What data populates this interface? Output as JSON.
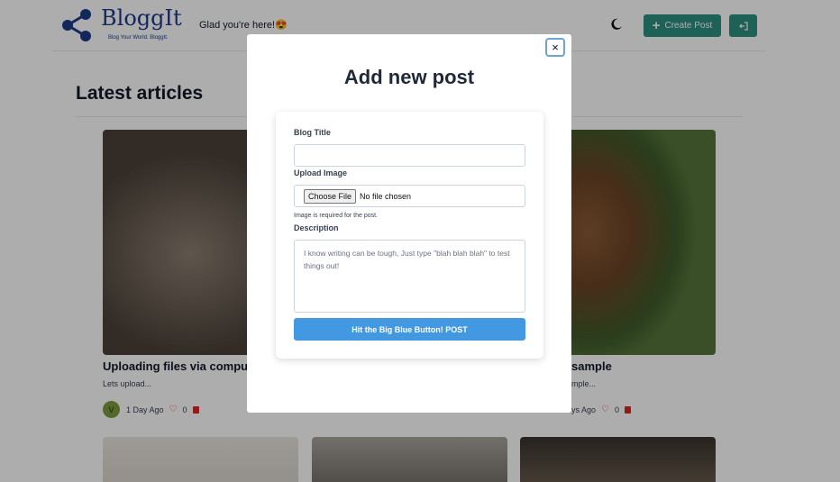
{
  "header": {
    "brand_name": "BloggIt",
    "brand_tagline": "Blog Your World. BloggIt.",
    "greeting": "Glad you're here!😍",
    "create_post_label": "Create Post",
    "accent_color": "#2d8f81"
  },
  "main": {
    "section_title": "Latest articles",
    "cards": [
      {
        "title": "Uploading files via compute",
        "excerpt": "Lets upload...",
        "avatar_letter": "V",
        "time": "1 Day Ago",
        "likes": "0"
      },
      {
        "title": "sample",
        "excerpt": "mple...",
        "time": "ys Ago",
        "likes": "0"
      }
    ]
  },
  "modal": {
    "title": "Add new post",
    "close_symbol": "×",
    "blog_title_label": "Blog Title",
    "upload_label": "Upload Image",
    "choose_file_label": "Choose File",
    "no_file_label": "No file chosen",
    "image_hint": "Image is required for the post.",
    "description_label": "Description",
    "description_placeholder": "I know writing can be tough, Just type \"blah blah blah\" to test things out!",
    "submit_label": "Hit the Big Blue Button! POST",
    "submit_color": "#4299e1"
  }
}
